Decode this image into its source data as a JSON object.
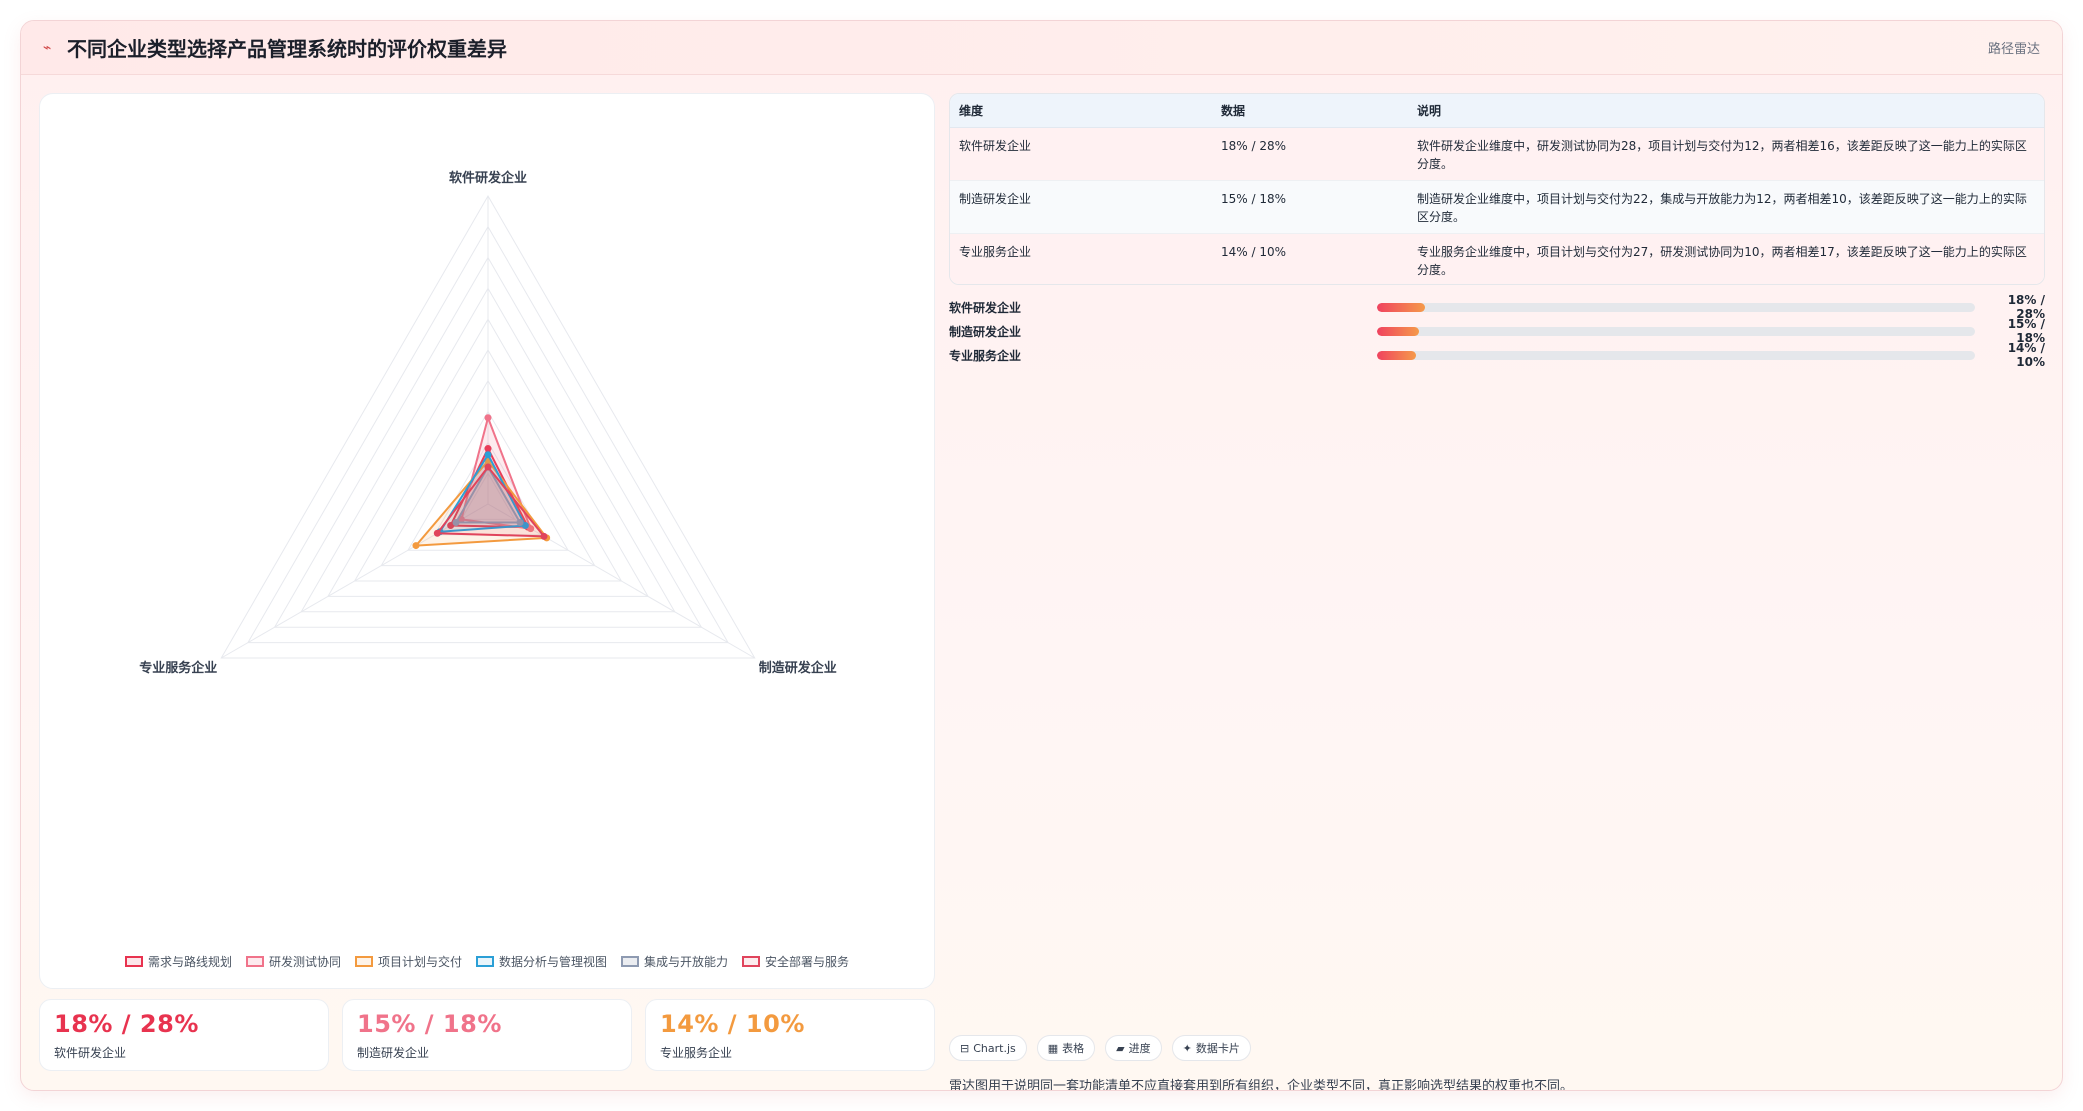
{
  "header": {
    "icon": "line-chart-icon",
    "title": "不同企业类型选择产品管理系统时的评价权重差异",
    "tag": "路径雷达"
  },
  "chart_data": {
    "type": "radar",
    "axes": [
      "软件研发企业",
      "制造研发企业",
      "专业服务企业"
    ],
    "r_range": [
      0,
      100
    ],
    "grid": true,
    "legend_position": "bottom",
    "series": [
      {
        "name": "需求与路线规划",
        "values": [
          18,
          15,
          14
        ],
        "color": "#e8334f",
        "fill": "rgba(232,51,79,0.12)"
      },
      {
        "name": "研发测试协同",
        "values": [
          28,
          16,
          10
        ],
        "color": "#f0738a",
        "fill": "rgba(240,115,138,0.15)"
      },
      {
        "name": "项目计划与交付",
        "values": [
          14,
          22,
          27
        ],
        "color": "#f39a3f",
        "fill": "rgba(243,154,63,0.12)"
      },
      {
        "name": "数据分析与管理视图",
        "values": [
          16,
          14,
          18
        ],
        "color": "#2b9fd6",
        "fill": "rgba(43,159,214,0.10)"
      },
      {
        "name": "集成与开放能力",
        "values": [
          12,
          12,
          12
        ],
        "color": "#8e9ab1",
        "fill": "rgba(142,154,177,0.18)"
      },
      {
        "name": "安全部署与服务",
        "values": [
          12,
          21,
          19
        ],
        "color": "#e0445c",
        "fill": "rgba(224,68,92,0.10)"
      }
    ]
  },
  "stats": [
    {
      "value": "18% / 28%",
      "label": "软件研发企业",
      "color": "#e8334f"
    },
    {
      "value": "15% / 18%",
      "label": "制造研发企业",
      "color": "#f0738a"
    },
    {
      "value": "14% / 10%",
      "label": "专业服务企业",
      "color": "#f39a3f"
    }
  ],
  "table": {
    "headers": [
      "维度",
      "数据",
      "说明"
    ],
    "rows": [
      {
        "dim": "软件研发企业",
        "data": "18% / 28%",
        "desc": "软件研发企业维度中，研发测试协同为28，项目计划与交付为12，两者相差16，该差距反映了这一能力上的实际区分度。"
      },
      {
        "dim": "制造研发企业",
        "data": "15% / 18%",
        "desc": "制造研发企业维度中，项目计划与交付为22，集成与开放能力为12，两者相差10，该差距反映了这一能力上的实际区分度。"
      },
      {
        "dim": "专业服务企业",
        "data": "14% / 10%",
        "desc": "专业服务企业维度中，项目计划与交付为27，研发测试协同为10，两者相差17，该差距反映了这一能力上的实际区分度。"
      }
    ]
  },
  "bars": [
    {
      "name": "软件研发企业",
      "value_text": "18% / 28%",
      "fraction": 0.08
    },
    {
      "name": "制造研发企业",
      "value_text": "15% / 18%",
      "fraction": 0.07
    },
    {
      "name": "专业服务企业",
      "value_text": "14% / 10%",
      "fraction": 0.065
    }
  ],
  "chips": [
    {
      "icon": "chart-icon",
      "glyph": "⊟",
      "label": "Chart.js"
    },
    {
      "icon": "table-icon",
      "glyph": "▦",
      "label": "表格"
    },
    {
      "icon": "progress-icon",
      "glyph": "▰",
      "label": "进度"
    },
    {
      "icon": "sparkle-icon",
      "glyph": "✦",
      "label": "数据卡片"
    }
  ],
  "note": "雷达图用于说明同一套功能清单不应直接套用到所有组织，企业类型不同，真正影响选型结果的权重也不同。"
}
